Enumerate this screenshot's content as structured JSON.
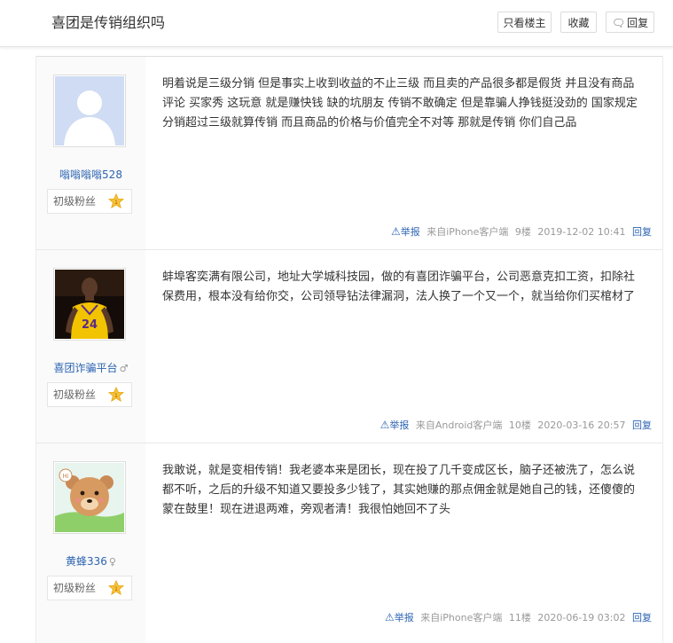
{
  "thread": {
    "title": "喜团是传销组织吗",
    "only_author": "只看楼主",
    "favorite": "收藏",
    "reply": "回复"
  },
  "posts": [
    {
      "user": "嗡嗡嗡嗡528",
      "gender": "",
      "level": "初级粉丝",
      "text": "明着说是三级分销 但是事实上收到收益的不止三级 而且卖的产品很多都是假货 并且没有商品评论 买家秀 这玩意 就是赚快钱 缺的坑朋友 传销不敢确定 但是靠骗人挣钱挺没劲的 国家规定分销超过三级就算传销 而且商品的价格与价值完全不对等 那就是传销 你们自己品",
      "report": "举报",
      "source": "来自iPhone客户端",
      "floor": "9楼",
      "time": "2019-12-02 10:41",
      "reply": "回复"
    },
    {
      "user": "喜团诈骗平台",
      "gender": "♂",
      "level": "初级粉丝",
      "text": "蚌埠客奕满有限公司，地址大学城科技园，做的有喜团诈骗平台，公司恶意克扣工资，扣除社保费用，根本没有给你交，公司领导钻法律漏洞，法人换了一个又一个，就当给你们买棺材了",
      "report": "举报",
      "source": "来自Android客户端",
      "floor": "10楼",
      "time": "2020-03-16 20:57",
      "reply": "回复"
    },
    {
      "user": "黄蜂336",
      "gender": "♀",
      "level": "初级粉丝",
      "text": "我敢说，就是变相传销！我老婆本来是团长，现在投了几千变成区长，脑子还被洗了，怎么说都不听，之后的升级不知道又要投多少钱了，其实她赚的那点佣金就是她自己的钱，还傻傻的蒙在鼓里！现在进退两难，旁观者清！我很怕她回不了头",
      "report": "举报",
      "source": "来自iPhone客户端",
      "floor": "11楼",
      "time": "2020-06-19 03:02",
      "reply": "回复"
    }
  ]
}
